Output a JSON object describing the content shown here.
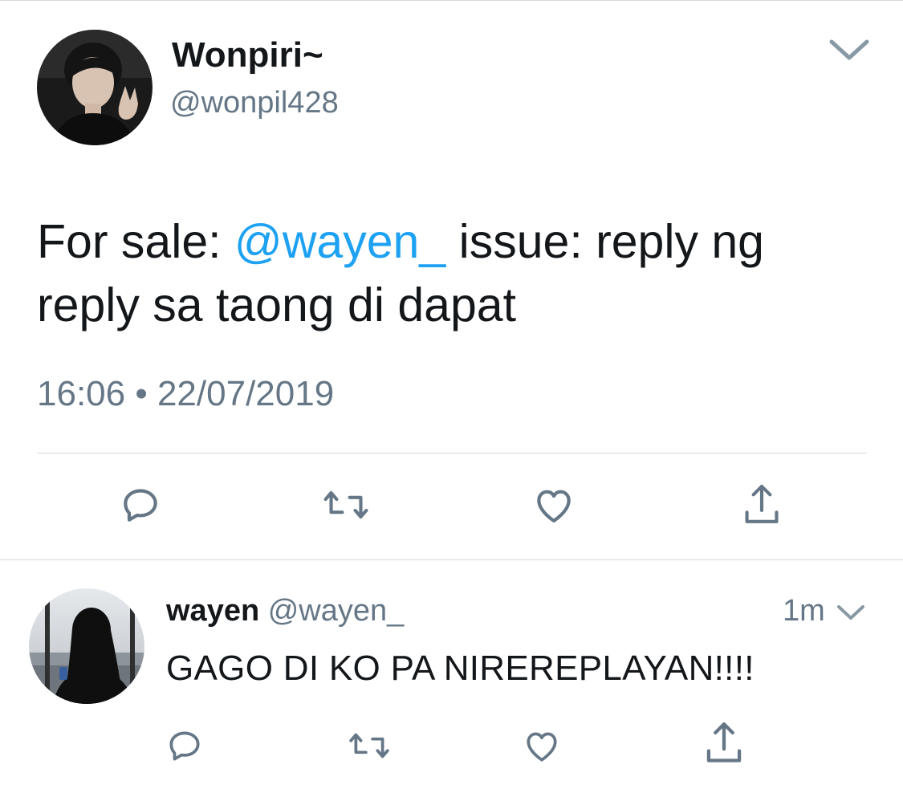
{
  "main_tweet": {
    "display_name": "Wonpiri~",
    "handle": "@wonpil428",
    "text_before": "For sale: ",
    "mention": "@wayen_",
    "text_after": " issue: reply ng reply sa taong di dapat",
    "timestamp": "16:06 • 22/07/2019",
    "actions": [
      "reply-icon",
      "retweet-icon",
      "like-icon",
      "share-icon"
    ]
  },
  "reply_tweet": {
    "display_name": "wayen",
    "handle": "@wayen_",
    "time_ago": "1m",
    "text": "GAGO DI KO PA NIREREPLAYAN!!!!",
    "actions": [
      "reply-icon",
      "retweet-icon",
      "like-icon",
      "share-icon"
    ]
  },
  "colors": {
    "primary_text": "#14171a",
    "secondary_text": "#657786",
    "link": "#1da1f2",
    "divider": "#d6d9dc",
    "icon": "#657786"
  }
}
